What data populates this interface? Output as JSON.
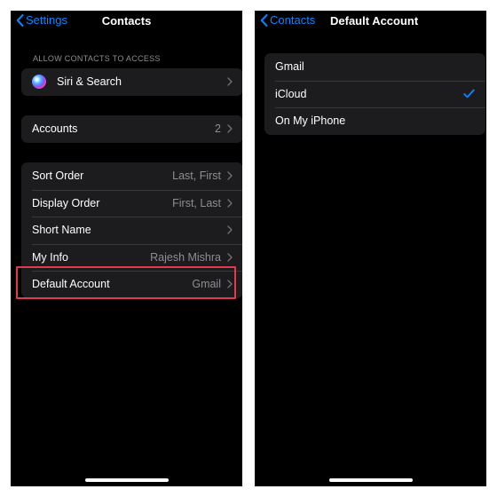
{
  "left_screen": {
    "back_label": "Settings",
    "title": "Contacts",
    "section_header": "ALLOW CONTACTS TO ACCESS",
    "siri_row": {
      "label": "Siri & Search"
    },
    "accounts_row": {
      "label": "Accounts",
      "value": "2"
    },
    "settings_rows": [
      {
        "label": "Sort Order",
        "value": "Last, First"
      },
      {
        "label": "Display Order",
        "value": "First, Last"
      },
      {
        "label": "Short Name",
        "value": ""
      },
      {
        "label": "My Info",
        "value": "Rajesh Mishra"
      },
      {
        "label": "Default Account",
        "value": "Gmail",
        "highlighted": true
      }
    ],
    "highlight_color": "#e03a4f"
  },
  "right_screen": {
    "back_label": "Contacts",
    "title": "Default Account",
    "options": [
      {
        "label": "Gmail",
        "selected": false
      },
      {
        "label": "iCloud",
        "selected": true
      },
      {
        "label": "On My iPhone",
        "selected": false
      }
    ]
  },
  "colors": {
    "accent": "#0a84ff",
    "background": "#000000",
    "cell": "#1c1c1e",
    "secondary_text": "#8e8e93"
  },
  "icons": {
    "back": "chevron-left-icon",
    "disclosure": "chevron-right-icon",
    "siri": "siri-icon",
    "selected": "checkmark-icon"
  }
}
